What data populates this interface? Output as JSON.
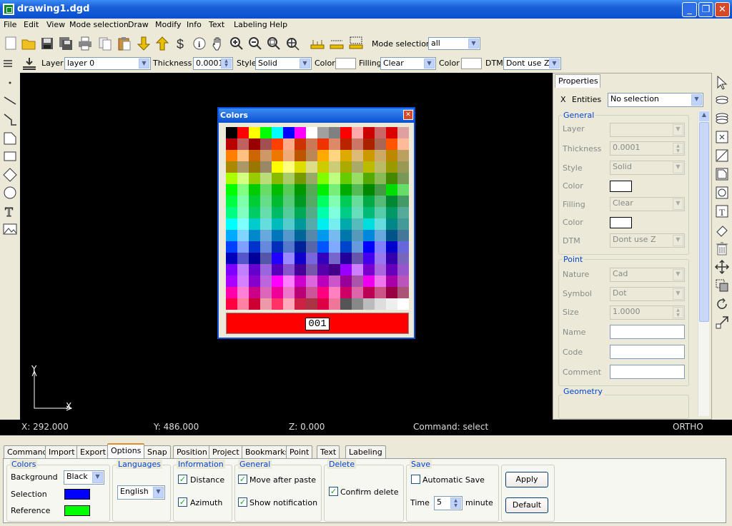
{
  "window": {
    "title": "drawing1.dgd",
    "minimize": "_",
    "restore": "❐",
    "close": "✕"
  },
  "menu": [
    "File",
    "Edit",
    "View",
    "Mode selection",
    "Draw",
    "Modify",
    "Info",
    "Text",
    "Labeling",
    "Help"
  ],
  "toolbar1": {
    "icons": [
      "new-icon",
      "open-folder-icon",
      "save-icon",
      "save-all-icon",
      "print-icon",
      "copy-icon",
      "paste-icon",
      "arrow-down-icon",
      "arrow-up-icon",
      "dollar-icon",
      "info-icon",
      "hand-pan-icon",
      "zoom-in-icon",
      "zoom-out-icon",
      "zoom-window-icon",
      "zoom-extents-icon",
      "ruler-icon",
      "measure-line-icon",
      "measure-area-icon"
    ],
    "mode_selection_label": "Mode selection",
    "mode_selection_value": "all"
  },
  "toolbar2": {
    "layer_label": "Layer",
    "layer_value": "layer 0",
    "thickness_label": "Thickness",
    "thickness_value": "0.0001",
    "style_label": "Style",
    "style_value": "Solid",
    "color_label": "Color",
    "filling_label": "Filling",
    "filling_value": "Clear",
    "color2_label": "Color",
    "dtm_label": "DTM",
    "dtm_value": "Dont use Z"
  },
  "canvas": {
    "axis_y": "Y",
    "axis_x": "X"
  },
  "colors_dialog": {
    "title": "Colors",
    "close": "✕",
    "selected_code": "001",
    "selected_color": "#ff0000",
    "palette": [
      [
        "#000000",
        "#ff0000",
        "#ffff00",
        "#00ff00",
        "#00ffff",
        "#0000ff",
        "#ff00ff",
        "#ffffff",
        "#a0a0a0",
        "#808080",
        "#ff0000",
        "#ffaaaa",
        "#cc0000",
        "#cc6666",
        "#dd0000",
        "#e0a0a0"
      ],
      [
        "#bb0000",
        "#c06060",
        "#990000",
        "#a05050",
        "#ff4000",
        "#ffaa88",
        "#cc3300",
        "#cc7755",
        "#ee3300",
        "#dd8866",
        "#bb2200",
        "#cc7766",
        "#aa2200",
        "#aa6655",
        "#ff5500",
        "#ffbb99"
      ],
      [
        "#ff8000",
        "#ffc080",
        "#cc6600",
        "#cc9966",
        "#ee7700",
        "#eeaa77",
        "#bb5500",
        "#bb8855",
        "#ffaa00",
        "#ffd580",
        "#ddaa00",
        "#ddbb77",
        "#cc9900",
        "#ccaa66",
        "#bb8800",
        "#bba060"
      ],
      [
        "#aa8800",
        "#aa9966",
        "#997700",
        "#998866",
        "#ffff00",
        "#ffff80",
        "#dddd00",
        "#dddd88",
        "#cccc00",
        "#cccc77",
        "#aaaa00",
        "#aaaa66",
        "#bbbb00",
        "#bbbb66",
        "#999900",
        "#999955"
      ],
      [
        "#aaff00",
        "#d5ff80",
        "#99cc00",
        "#bbdd77",
        "#88bb00",
        "#aacc66",
        "#779900",
        "#99aa66",
        "#80ff00",
        "#bfff80",
        "#66cc00",
        "#99dd66",
        "#55aa00",
        "#88bb55",
        "#448800",
        "#779955"
      ],
      [
        "#00ff00",
        "#80ff80",
        "#00cc00",
        "#66dd66",
        "#00bb00",
        "#55cc55",
        "#009900",
        "#55aa55",
        "#00ee00",
        "#77ee77",
        "#00aa00",
        "#55bb55",
        "#008800",
        "#449944",
        "#00dd00",
        "#66dd66"
      ],
      [
        "#00ff40",
        "#80ffaa",
        "#00cc33",
        "#66dd88",
        "#00bb30",
        "#55cc77",
        "#009922",
        "#55aa66",
        "#00ff60",
        "#80ffb0",
        "#00cc55",
        "#66dd99",
        "#00aa44",
        "#55bb77",
        "#008833",
        "#449966"
      ],
      [
        "#00ff80",
        "#80ffc0",
        "#00cc66",
        "#66ddaa",
        "#00bb66",
        "#55cc99",
        "#00aa55",
        "#55aa88",
        "#00ffaa",
        "#80ffdd",
        "#00cc88",
        "#66ddbb",
        "#00bb77",
        "#55ccaa",
        "#009966",
        "#55aa99"
      ],
      [
        "#00ffff",
        "#80ffff",
        "#00cccc",
        "#66dddd",
        "#00bbbb",
        "#55cccc",
        "#009999",
        "#55aaaa",
        "#00eeee",
        "#77eeee",
        "#00aaaa",
        "#55bbbb",
        "#00dddd",
        "#66dddd",
        "#008888",
        "#449999"
      ],
      [
        "#00aaff",
        "#80d5ff",
        "#0088cc",
        "#66aadd",
        "#0077bb",
        "#5599cc",
        "#006699",
        "#5588aa",
        "#0099ee",
        "#77bbee",
        "#0077aa",
        "#5599bb",
        "#0088dd",
        "#66aadd",
        "#005588",
        "#447799"
      ],
      [
        "#0040ff",
        "#80a0ff",
        "#0033cc",
        "#6688dd",
        "#0030bb",
        "#5577cc",
        "#002299",
        "#5566aa",
        "#0055ff",
        "#80aaff",
        "#0044cc",
        "#6699dd",
        "#0000ff",
        "#8080ff",
        "#0000cc",
        "#6666dd"
      ],
      [
        "#0000bb",
        "#5555cc",
        "#000099",
        "#5555aa",
        "#2200ff",
        "#9988ff",
        "#1100cc",
        "#7766dd",
        "#3300bb",
        "#7766cc",
        "#220099",
        "#6655aa",
        "#4400ee",
        "#9977ee",
        "#3300aa",
        "#7766bb"
      ],
      [
        "#8000ff",
        "#c080ff",
        "#6600cc",
        "#9966dd",
        "#5500bb",
        "#8855cc",
        "#440099",
        "#7755aa",
        "#5500aa",
        "#440088",
        "#9900ff",
        "#cc80ff",
        "#7700cc",
        "#aa66dd",
        "#6600bb",
        "#9955cc"
      ],
      [
        "#aa00ff",
        "#d580ff",
        "#8800cc",
        "#bb66dd",
        "#ff00ff",
        "#ff80ff",
        "#cc00cc",
        "#dd66dd",
        "#bb00bb",
        "#cc55cc",
        "#990099",
        "#aa55aa",
        "#ee00ee",
        "#ee77ee",
        "#aa00aa",
        "#bb55bb"
      ],
      [
        "#ff00aa",
        "#ff80d5",
        "#cc0088",
        "#dd66bb",
        "#ee0099",
        "#ee77cc",
        "#bb0077",
        "#cc5599",
        "#ff0080",
        "#ff80c0",
        "#cc0066",
        "#dd66aa",
        "#bb0055",
        "#cc5588",
        "#990044",
        "#aa5577"
      ],
      [
        "#ff0040",
        "#ff80a0",
        "#cc0033",
        "#ee99aa",
        "#ff3366",
        "#ffaabb",
        "#cc2244",
        "#aa3344",
        "#dd0044",
        "#ee7799",
        "#555555",
        "#888888",
        "#bbbbbb",
        "#dddddd",
        "#eeeeee",
        "#ffffff"
      ]
    ]
  },
  "properties": {
    "tab": "Properties",
    "close": "X",
    "entities_label": "Entities",
    "entities_value": "No selection",
    "general_title": "General",
    "layer_label": "Layer",
    "thickness_label": "Thickness",
    "thickness_value": "0.0001",
    "style_label": "Style",
    "style_value": "Solid",
    "color_label": "Color",
    "filling_label": "Filling",
    "filling_value": "Clear",
    "color2_label": "Color",
    "dtm_label": "DTM",
    "dtm_value": "Dont use Z",
    "point_title": "Point",
    "nature_label": "Nature",
    "nature_value": "Cad",
    "symbol_label": "Symbol",
    "symbol_value": "Dot",
    "size_label": "Size",
    "size_value": "1.0000",
    "name_label": "Name",
    "code_label": "Code",
    "comment_label": "Comment",
    "geometry_title": "Geometry"
  },
  "status": {
    "x": "X: 292.000",
    "y": "Y: 486.000",
    "z": "Z: 0.000",
    "command": "Command: select",
    "ortho": "ORTHO"
  },
  "tabs": [
    "Command",
    "Import",
    "Export",
    "Options",
    "Snap",
    "Position",
    "Project",
    "Bookmarks",
    "Point",
    "Text",
    "Labeling"
  ],
  "active_tab": "Options",
  "options": {
    "colors_title": "Colors",
    "background_label": "Background",
    "background_value": "Black",
    "selection_label": "Selection",
    "selection_color": "#0000ff",
    "reference_label": "Reference",
    "reference_color": "#00ff00",
    "languages_title": "Languages",
    "language_value": "English",
    "information_title": "Information",
    "distance_label": "Distance",
    "azimuth_label": "Azimuth",
    "general_title": "General",
    "move_after_paste_label": "Move after paste",
    "show_notification_label": "Show notification",
    "delete_title": "Delete",
    "confirm_delete_label": "Confirm delete",
    "save_title": "Save",
    "automatic_save_label": "Automatic Save",
    "time_label": "Time",
    "time_value": "5",
    "minute_label": "minute",
    "apply_label": "Apply",
    "default_label": "Default",
    "check_mark": "✓"
  }
}
